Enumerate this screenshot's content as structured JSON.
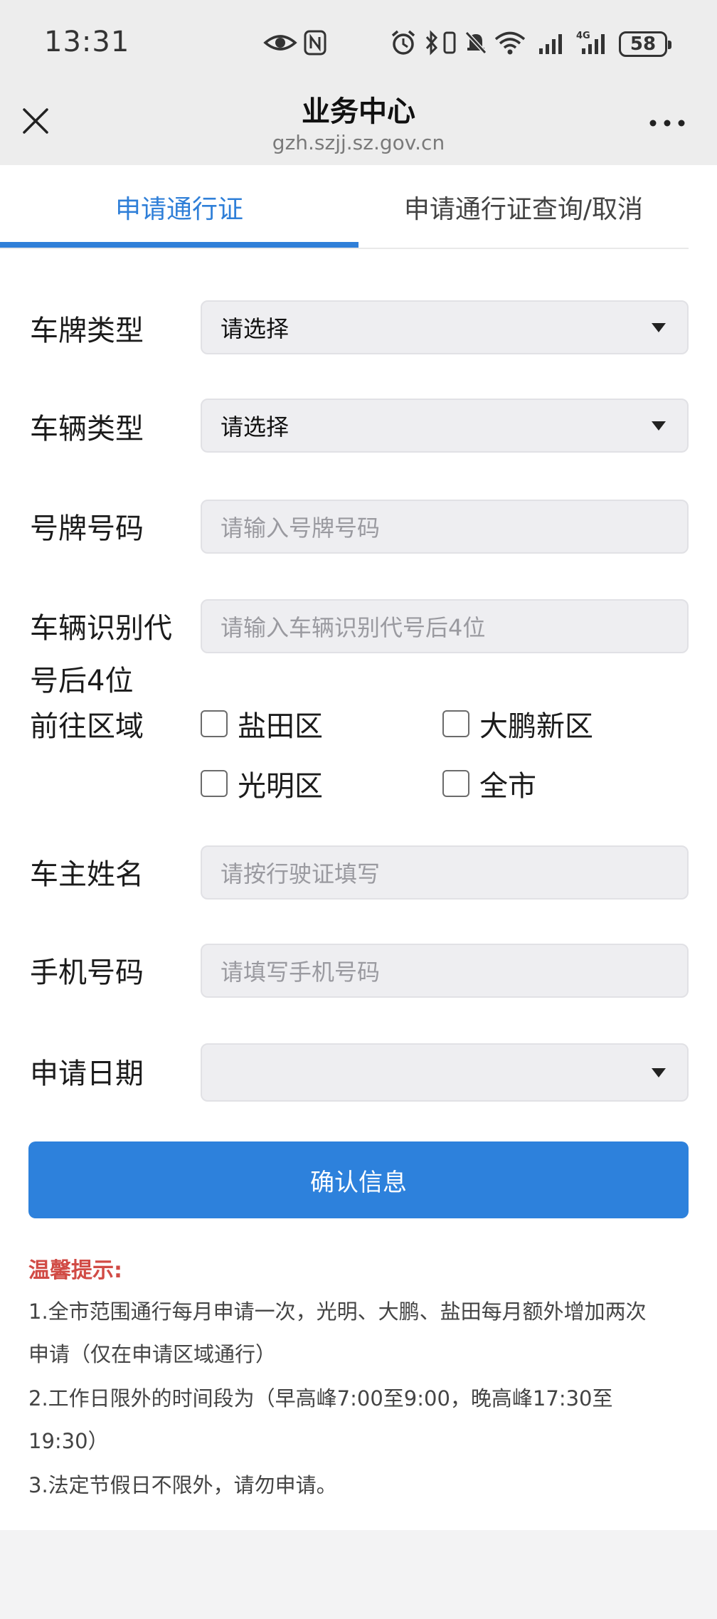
{
  "status_bar": {
    "time": "13:31",
    "battery": "58",
    "network": "4G",
    "icons": [
      "eye-icon",
      "nfc-icon",
      "alarm-icon",
      "bluetooth-icon",
      "vibrate-icon",
      "mute-icon",
      "wifi-icon",
      "signal-icon",
      "signal-4g-icon",
      "battery-icon"
    ]
  },
  "nav": {
    "title": "业务中心",
    "url": "gzh.szjj.sz.gov.cn"
  },
  "tabs": [
    {
      "label": "申请通行证",
      "active": true
    },
    {
      "label": "申请通行证查询/取消",
      "active": false
    }
  ],
  "form": {
    "plate_type": {
      "label": "车牌类型",
      "value": "请选择"
    },
    "vehicle_type": {
      "label": "车辆类型",
      "value": "请选择"
    },
    "plate_number": {
      "label": "号牌号码",
      "placeholder": "请输入号牌号码"
    },
    "vin": {
      "label_line1": "车辆识别代",
      "label_line2": "号后4位",
      "placeholder": "请输入车辆识别代号后4位"
    },
    "region": {
      "label": "前往区域",
      "options": [
        "盐田区",
        "大鹏新区",
        "光明区",
        "全市"
      ]
    },
    "owner_name": {
      "label": "车主姓名",
      "placeholder": "请按行驶证填写"
    },
    "phone": {
      "label": "手机号码",
      "placeholder": "请填写手机号码"
    },
    "date": {
      "label": "申请日期",
      "value": ""
    }
  },
  "confirm_label": "确认信息",
  "tips": {
    "title": "温馨提示:",
    "lines": [
      "1.全市范围通行每月申请一次，光明、大鹏、盐田每月额外增加两次",
      "申请（仅在申请区域通行）",
      "2.工作日限外的时间段为（早高峰7:00至9:00，晚高峰17:30至",
      "19:30）",
      "3.法定节假日不限外，请勿申请。"
    ]
  },
  "colors": {
    "accent": "#2f7fd8",
    "button": "#2d81dc",
    "tip_title": "#d14b45"
  }
}
